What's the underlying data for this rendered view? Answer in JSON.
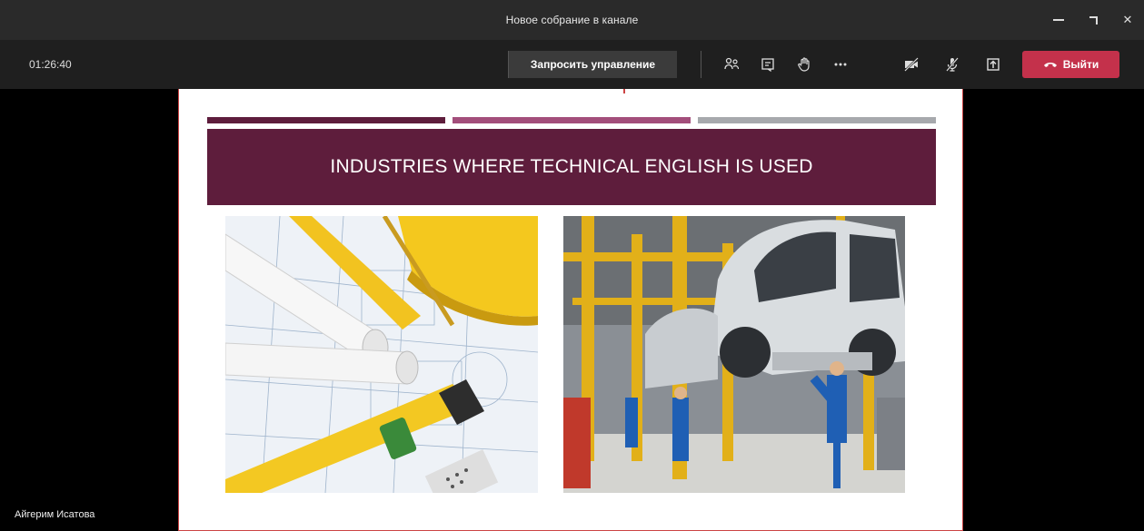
{
  "window": {
    "title": "Новое собрание в канале"
  },
  "toolbar": {
    "timer": "01:26:40",
    "request_control_label": "Запросить управление",
    "leave_label": "Выйти",
    "icons": [
      "participants-icon",
      "chat-icon",
      "raise-hand-icon",
      "more-icon",
      "camera-off-icon",
      "mic-off-icon",
      "share-tray-icon"
    ]
  },
  "slide": {
    "heading": "INDUSTRIES WHERE TECHNICAL ENGLISH IS USED",
    "bar_colors": [
      "#5e1d3c",
      "#a34e7b",
      "#a7a9ad"
    ],
    "banner_color": "#5e1d3c",
    "images": [
      "blueprint-tools-image",
      "car-factory-image"
    ]
  },
  "participant": {
    "name": "Айгерим Исатова"
  },
  "colors": {
    "leave": "#c4314b",
    "titlebar": "#2a2a2a",
    "toolbar": "#1f1f1f"
  }
}
